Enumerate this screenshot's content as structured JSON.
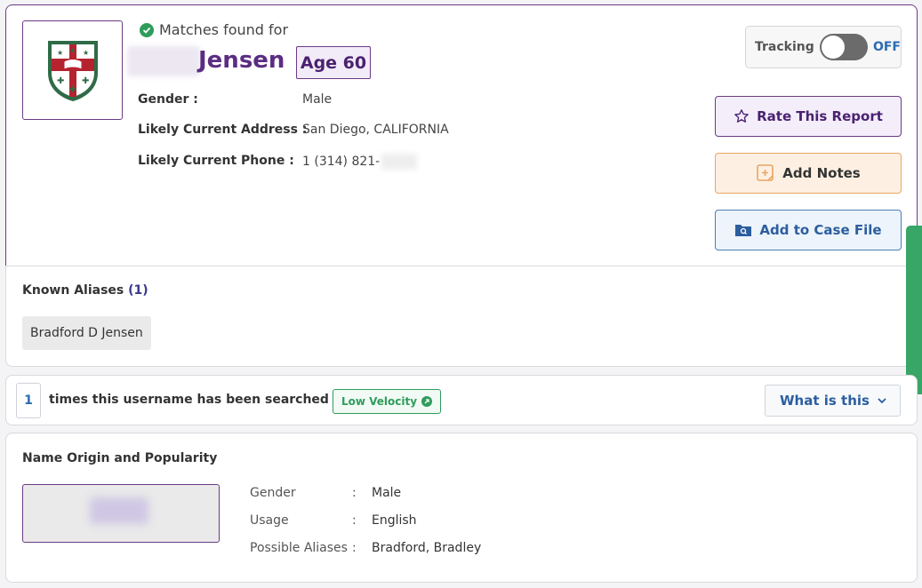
{
  "profile": {
    "matches_label": "Matches found for",
    "last_name": "Jensen",
    "age_label": "Age 60",
    "fields": [
      {
        "label": "Gender :",
        "value": "Male"
      },
      {
        "label": "Likely Current Address :",
        "value": "San Diego, CALIFORNIA"
      },
      {
        "label": "Likely Current Phone :",
        "value": "1 (314) 821-"
      }
    ]
  },
  "tracking": {
    "label": "Tracking",
    "state": "OFF"
  },
  "actions": {
    "rate": "Rate This Report",
    "notes": "Add Notes",
    "case_file": "Add to Case File"
  },
  "aliases": {
    "title": "Known Aliases",
    "count": "(1)",
    "items": [
      "Bradford D Jensen"
    ]
  },
  "search_stats": {
    "count": "1",
    "text": "times this username has been searched",
    "velocity": "Low Velocity",
    "what_label": "What is this"
  },
  "origin": {
    "title": "Name Origin and Popularity",
    "details": [
      {
        "label": "Gender",
        "value": "Male"
      },
      {
        "label": "Usage",
        "value": "English"
      },
      {
        "label": "Possible Aliases",
        "value": "Bradford, Bradley"
      }
    ]
  },
  "colors": {
    "brand_purple": "#5b2d82",
    "accent_green": "#2e9d5b",
    "link_blue": "#2b6cb0",
    "notes_orange": "#e8a664"
  }
}
